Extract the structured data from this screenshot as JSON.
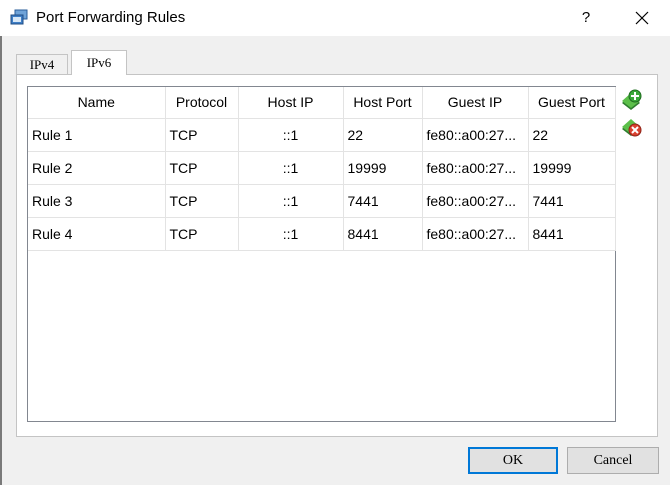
{
  "window": {
    "title": "Port Forwarding Rules",
    "help_label": "?",
    "icon": "virtualbox-window-icon"
  },
  "tabs": [
    {
      "label": "IPv4",
      "selected": false
    },
    {
      "label": "IPv6",
      "selected": true
    }
  ],
  "table": {
    "columns": [
      "Name",
      "Protocol",
      "Host IP",
      "Host Port",
      "Guest IP",
      "Guest Port"
    ],
    "rows": [
      [
        "Rule 1",
        "TCP",
        "::1",
        "22",
        "fe80::a00:27...",
        "22"
      ],
      [
        "Rule 2",
        "TCP",
        "::1",
        "19999",
        "fe80::a00:27...",
        "19999"
      ],
      [
        "Rule 3",
        "TCP",
        "::1",
        "7441",
        "fe80::a00:27...",
        "7441"
      ],
      [
        "Rule 4",
        "TCP",
        "::1",
        "8441",
        "fe80::a00:27...",
        "8441"
      ]
    ]
  },
  "side_actions": {
    "add_icon": "add-rule-icon",
    "remove_icon": "remove-rule-icon"
  },
  "buttons": {
    "ok": "OK",
    "cancel": "Cancel"
  },
  "colors": {
    "accent": "#0078d7",
    "add": "#3aa83a",
    "remove": "#d9412f"
  }
}
